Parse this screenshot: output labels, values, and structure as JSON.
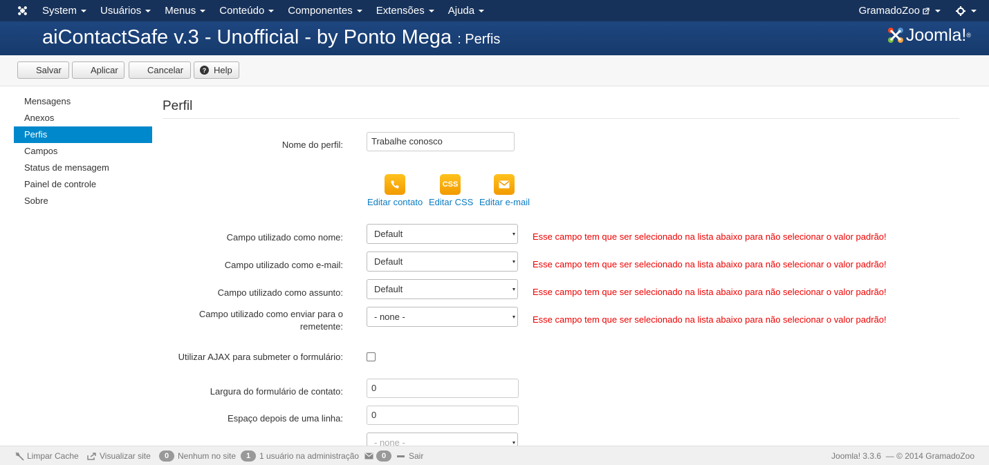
{
  "navbar": {
    "menu": [
      "System",
      "Usuários",
      "Menus",
      "Conteúdo",
      "Componentes",
      "Extensões",
      "Ajuda"
    ],
    "site_name": "GramadoZoo",
    "icons": [
      "joomla-icon",
      "external-link-icon",
      "gear-icon"
    ]
  },
  "header": {
    "title": "aiContactSafe v.3 - Unofficial - by Ponto Mega",
    "subtitle": ": Perfis",
    "logo_text": "Joomla!",
    "logo_mark": "®"
  },
  "toolbar": {
    "save": "Salvar",
    "apply": "Aplicar",
    "cancel": "Cancelar",
    "help": "Help"
  },
  "sidebar": {
    "items": [
      "Mensagens",
      "Anexos",
      "Perfis",
      "Campos",
      "Status de mensagem",
      "Painel de controle",
      "Sobre"
    ],
    "active": "Perfis"
  },
  "main": {
    "heading": "Perfil",
    "profile_name_label": "Nome do perfil:",
    "profile_name_value": "Trabalhe conosco",
    "actions": [
      {
        "label": "Editar contato",
        "icon": "phone-icon"
      },
      {
        "label": "Editar CSS",
        "icon": "css-icon",
        "icon_text": "CSS"
      },
      {
        "label": "Editar e-mail",
        "icon": "envelope-icon"
      }
    ],
    "fields": [
      {
        "label": "Campo utilizado como nome:",
        "value": "Default"
      },
      {
        "label": "Campo utilizado como e-mail:",
        "value": "Default"
      },
      {
        "label": "Campo utilizado como assunto:",
        "value": "Default"
      },
      {
        "label": "Campo utilizado como enviar para o remetente:",
        "value": "- none -"
      }
    ],
    "warning": "Esse campo tem que ser selecionado na lista abaixo para não selecionar o valor padrão!",
    "ajax_label": "Utilizar AJAX para submeter o formulário:",
    "ajax_checked": false,
    "width_label": "Largura do formulário de contato:",
    "width_value": "0",
    "spacing_label": "Espaço depois de uma linha:",
    "spacing_value": "0",
    "partial_select_value": "- none -"
  },
  "statusbar": {
    "clear_cache": "Limpar Cache",
    "view_site": "Visualizar site",
    "site_count": "0",
    "site_text": "Nenhum no site",
    "admin_count": "1",
    "admin_text": "1 usuário na administração",
    "messages_count": "0",
    "logout": "Sair",
    "version": "Joomla! 3.3.6",
    "copyright": "— © 2014 GramadoZoo"
  },
  "colors": {
    "navbar": "#17325a",
    "header": "#1a3f72",
    "accent": "#0088cc",
    "warning": "#ee0000",
    "icon_tile": "#f7a600"
  }
}
